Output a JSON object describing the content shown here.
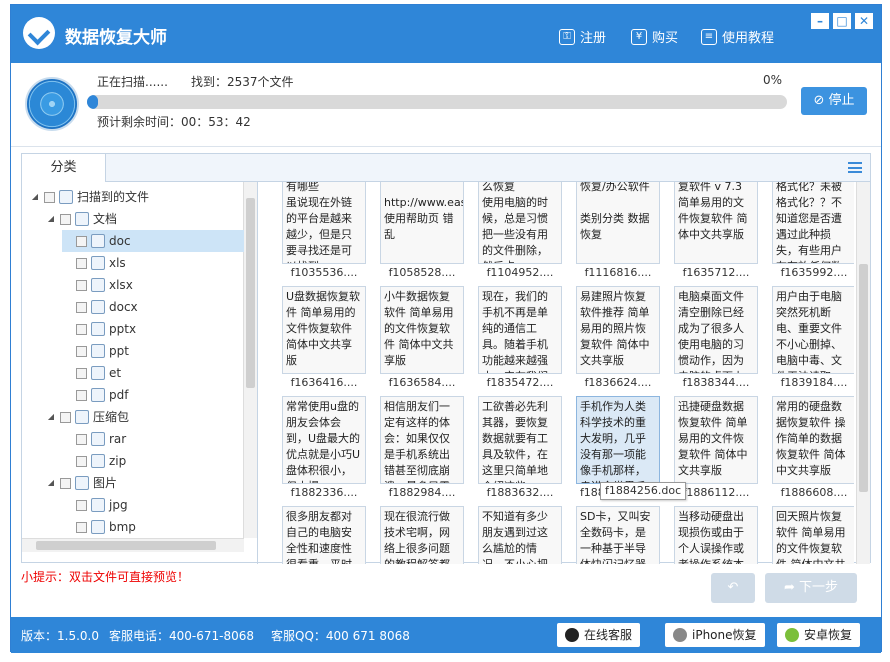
{
  "titlebar": {
    "title": "数据恢复大师",
    "register": "注册",
    "buy": "购买",
    "tutorial": "使用教程",
    "register_icon": "key-icon",
    "buy_icon": "yen-icon",
    "tutorial_icon": "book-icon"
  },
  "scan": {
    "status": "正在扫描......",
    "found": "找到：2537个文件",
    "percent": "0%",
    "progress_fraction": 0.015,
    "remaining": "预计剩余时间：00：53：42",
    "stop_label": "停止"
  },
  "panel": {
    "tab_label": "分类"
  },
  "tree": [
    {
      "label": "扫描到的文件",
      "level": 0,
      "toggle": "◢",
      "icon": "list-icon"
    },
    {
      "label": "文档",
      "level": 1,
      "toggle": "◢",
      "icon": "folder-icon"
    },
    {
      "label": "doc",
      "level": 2,
      "toggle": "",
      "icon": "doc-file-icon",
      "selected": true
    },
    {
      "label": "xls",
      "level": 2,
      "toggle": "",
      "icon": "xls-file-icon"
    },
    {
      "label": "xlsx",
      "level": 2,
      "toggle": "",
      "icon": "xlsx-file-icon"
    },
    {
      "label": "docx",
      "level": 2,
      "toggle": "",
      "icon": "docx-file-icon"
    },
    {
      "label": "pptx",
      "level": 2,
      "toggle": "",
      "icon": "pptx-file-icon"
    },
    {
      "label": "ppt",
      "level": 2,
      "toggle": "",
      "icon": "ppt-file-icon"
    },
    {
      "label": "et",
      "level": 2,
      "toggle": "",
      "icon": "et-file-icon"
    },
    {
      "label": "pdf",
      "level": 2,
      "toggle": "",
      "icon": "pdf-file-icon"
    },
    {
      "label": "压缩包",
      "level": 1,
      "toggle": "◢",
      "icon": "archive-icon"
    },
    {
      "label": "rar",
      "level": 2,
      "toggle": "",
      "icon": "rar-file-icon"
    },
    {
      "label": "zip",
      "level": 2,
      "toggle": "",
      "icon": "zip-file-icon"
    },
    {
      "label": "图片",
      "level": 1,
      "toggle": "◢",
      "icon": "image-icon"
    },
    {
      "label": "jpg",
      "level": 2,
      "toggle": "",
      "icon": "jpg-file-icon"
    },
    {
      "label": "bmp",
      "level": 2,
      "toggle": "",
      "icon": "bmp-file-icon"
    }
  ],
  "files": [
    {
      "text": "有哪些\n虽说现在外链的平台是越来越少，但是只要寻找还是可以找到",
      "name": "f1035536...."
    },
    {
      "text": "\nhttp://www.eas使用帮助页 错乱",
      "name": "f1058528...."
    },
    {
      "text": "么恢复\n使用电脑的时候，总是习惯把一些没有用的文件删除，然后点",
      "name": "f1104952...."
    },
    {
      "text": "恢复/办公软件\n\n类别分类 数据恢复",
      "name": "f1116816...."
    },
    {
      "text": "复软件 v 7.3 简单易用的文件恢复软件 简体中文共享版",
      "name": "f1635712...."
    },
    {
      "text": "格式化？未被格式化？？不知道您是否遭遇过此种损失，有些用户在存放任何数据",
      "name": "f1635992...."
    },
    {
      "text": "U盘数据恢复软件 简单易用的文件恢复软件 简体中文共享版\n\n软件大小",
      "name": "f1636416...."
    },
    {
      "text": "小牛数据恢复软件 简单易用的文件恢复软件 简体中文共享版\n\n软件大小",
      "name": "f1636584...."
    },
    {
      "text": "现在，我们的手机不再是单纯的通信工具。随着手机功能越来越强大，它在我们生活中扮演的角色",
      "name": "f1835472...."
    },
    {
      "text": "易建照片恢复软件推荐 简单易用的照片恢复软件 简体中文共享版",
      "name": "f1836624...."
    },
    {
      "text": "电脑桌面文件清空删除已经成为了很多人使用电脑的习惯动作，因为电脑的桌面上大多放的文件",
      "name": "f1838344...."
    },
    {
      "text": "用户由于电脑突然死机断电、重要文件不小心删掉、电脑中毒、文件无法读取、系统崩溃等问题",
      "name": "f1839184...."
    },
    {
      "text": "常常使用u盘的朋友会体会到，U盘最大的优点就是小巧U盘体积很小，但大提",
      "name": "f1882336...."
    },
    {
      "text": "相信朋友们一定有这样的体会：如果仅仅是手机系统出错甚至彻底崩溃，最多只需要重新",
      "name": "f1882984...."
    },
    {
      "text": "工欲善必先利其器，要恢复数据就要有工具及软件，在这里只简单地介绍这些",
      "name": "f1883632...."
    },
    {
      "text": "手机作为人类科学技术的重大发明，几乎没有那一项能像手机那样，走进全世界千家万户",
      "name": "f1884256.doc",
      "highlighted": true
    },
    {
      "text": "迅捷硬盘数据恢复软件 简单易用的文件恢复软件 简体中文共享版",
      "name": "f1886112...."
    },
    {
      "text": "常用的硬盘数据恢复软件 操作简单的数据恢复软件 简体中文共享版",
      "name": "f1886608...."
    },
    {
      "text": "很多朋友都对自己的电脑安全性和速度性很看重，平时也会",
      "name": ""
    },
    {
      "text": "现在很流行做技术宅啊，网络上很多问题的教程解答都很丰",
      "name": ""
    },
    {
      "text": "不知道有多少朋友遇到过这么尴尬的情况，不小心把回收站清空",
      "name": ""
    },
    {
      "text": "SD卡，又叫安全数码卡，是一种基于半导体快闪记忆器的新一代",
      "name": ""
    },
    {
      "text": "当移动硬盘出现损伤或由于个人误操作或者操作系统本身故障导",
      "name": ""
    },
    {
      "text": "回天照片恢复软件 简单易用的文件恢复软件 简体中文共享版",
      "name": ""
    }
  ],
  "tooltip": "f1884256.doc",
  "hint": "小提示：双击文件可直接预览！",
  "nav": {
    "back_label": "",
    "next_label": "下一步"
  },
  "status": {
    "version": "版本：1.5.0.0",
    "phone": "客服电话：400-671-8068",
    "qq": "客服QQ：400 671 8068",
    "online": "在线客服",
    "iphone": "iPhone恢复",
    "android": "安卓恢复"
  },
  "colors": {
    "accent": "#2f86d8",
    "hint": "#e00000",
    "selected_row": "#cde4f7"
  }
}
